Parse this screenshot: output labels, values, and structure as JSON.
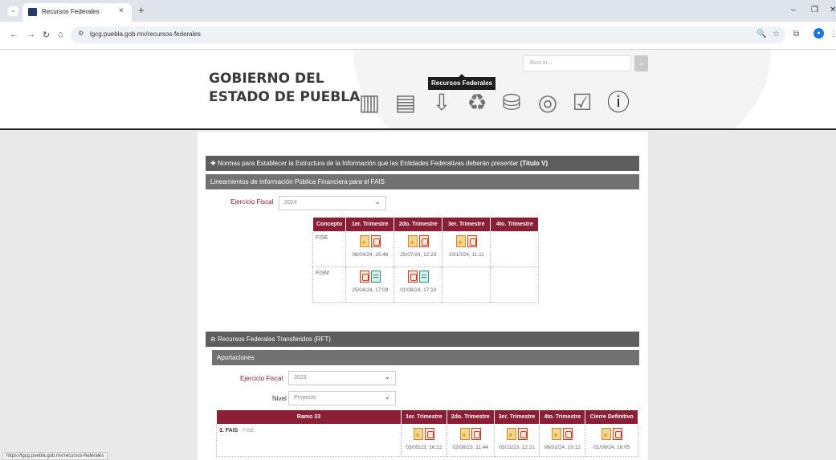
{
  "browser": {
    "tab_title": "Recursos Federales",
    "tab_close": "×",
    "new_tab": "+",
    "url": "lgcg.puebla.gob.mx/recursos-federales",
    "status_url": "https://lgcg.puebla.gob.mx/recursos-federales"
  },
  "site": {
    "logo_line1": "GOBIERNO DEL",
    "logo_line2": "ESTADO DE PUEBLA",
    "search_placeholder": "Buscar...",
    "tooltip": "Recursos Federales"
  },
  "section1": {
    "header_text": "Normas para Establecer la Estructura de la Información que las Entidades Federativas deberán presentar ",
    "header_bold": "(Titulo V)",
    "sub_header": "Lineamientos de Información Pública Financiera para el FAIS",
    "fiscal_label": "Ejercicio Fiscal",
    "fiscal_value": "2024",
    "table": {
      "headers": [
        "Concepto",
        "1er. Trimestre",
        "2do. Trimestre",
        "3er. Trimestre",
        "4to. Trimestre"
      ],
      "rows": [
        {
          "concepto": "FISE",
          "dates": [
            "08/04/24, 15:46",
            "25/07/24, 12:23",
            "10/10/24, 11:11",
            ""
          ],
          "icons": [
            "zip pdf",
            "zip pdf",
            "zip pdf",
            ""
          ]
        },
        {
          "concepto": "FISM",
          "dates": [
            "25/04/24, 17:09",
            "01/08/24, 17:10",
            "",
            ""
          ],
          "icons": [
            "pdf xls",
            "pdf xls",
            "",
            ""
          ]
        }
      ]
    }
  },
  "section2": {
    "header_text": "Recursos Federales Transferidos (RFT)",
    "sub_header": "Aportaciones",
    "fiscal_label": "Ejercicio Fiscal",
    "fiscal_value": "2023",
    "nivel_label": "Nivel",
    "nivel_value": "Proyecto",
    "table": {
      "headers": [
        "Ramo 33",
        "1er. Trimestre",
        "2do. Trimestre",
        "3er. Trimestre",
        "4to. Trimestre",
        "Cierre Definitivo"
      ],
      "rows": [
        {
          "ramo": "3. FAIS",
          "ramo_sub": " - FISE",
          "dates": [
            "03/05/23, 16:22",
            "02/08/23, 11:44",
            "03/11/23, 12:21",
            "06/02/24, 10:12",
            "01/08/24, 18:05"
          ]
        }
      ]
    }
  },
  "colors": {
    "accent": "#8b1d35",
    "bar": "#5e5e5e",
    "header_border": "#222222"
  }
}
